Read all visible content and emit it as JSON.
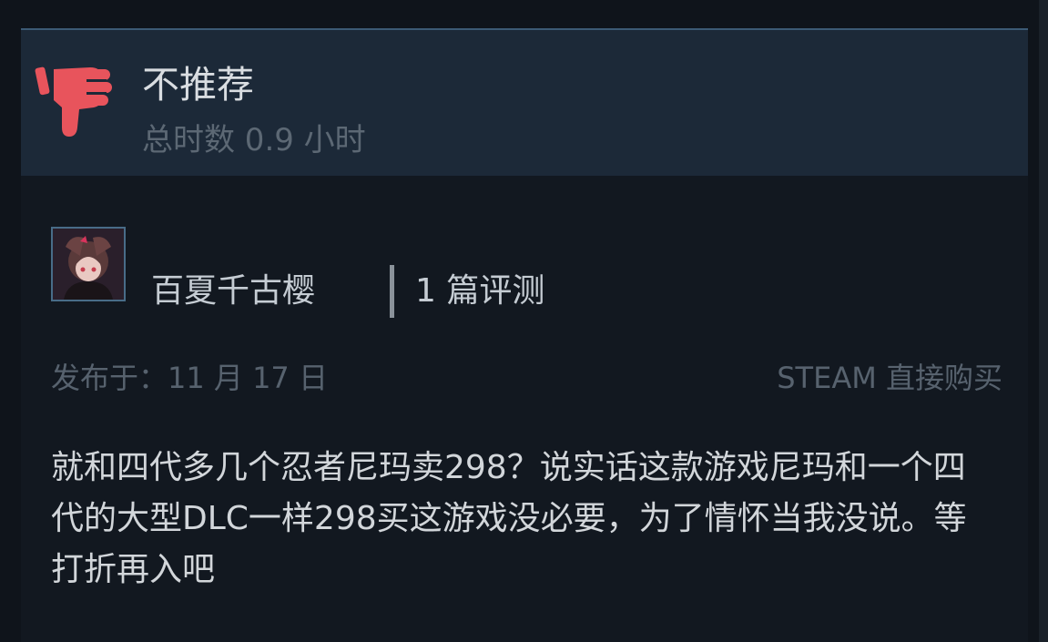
{
  "review": {
    "verdict": "不推荐",
    "hours": "总时数 0.9 小时",
    "verdict_icon": "thumbs-down-icon",
    "verdict_color": "#e8545c"
  },
  "author": {
    "name": "百夏千古樱",
    "review_count": "1 篇评测"
  },
  "meta": {
    "posted": "发布于：11 月 17 日",
    "source": "STEAM 直接购买"
  },
  "content": {
    "text": "就和四代多几个忍者尼玛卖298？说实话这款游戏尼玛和一个四代的大型DLC一样298买这游戏没必要，为了情怀当我没说。等打折再入吧"
  },
  "colors": {
    "background": "#11161e",
    "header_bg": "#1c2938",
    "accent_border": "#3c5a74",
    "muted_text": "#5c6874"
  }
}
